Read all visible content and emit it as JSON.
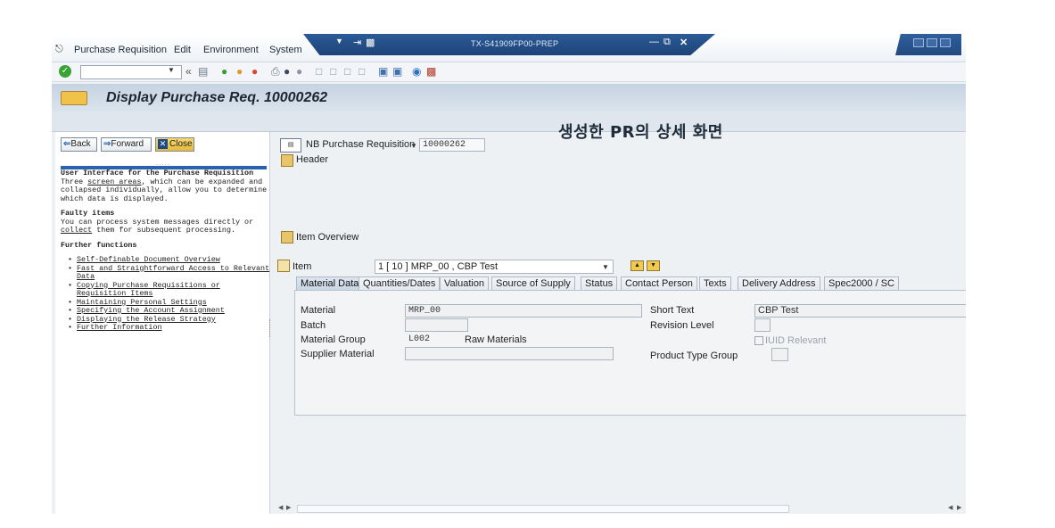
{
  "menubar": {
    "items": [
      "Purchase Requisition",
      "Edit",
      "Environment",
      "System"
    ],
    "window_title": "TX-S41909FP00-PREP"
  },
  "toolbar": {
    "command_field": ""
  },
  "page": {
    "title": "Display Purchase Req. 10000262"
  },
  "annotation": "생성한 PR의 상세 화면",
  "help": {
    "back_label": "Back",
    "forward_label": "Forward",
    "close_label": "Close",
    "heading": "User Interface for the Purchase Requisition",
    "intro_prefix": "Three ",
    "intro_link": "screen areas",
    "intro_rest": ", which can be expanded and collapsed individually, allow you to determine which data is displayed.",
    "faulty_heading": "Faulty items",
    "faulty_prefix": "You can process system messages directly or ",
    "faulty_link": "collect",
    "faulty_rest": " them for subsequent processing.",
    "functions_heading": "Further functions",
    "functions": [
      "Self-Definable Document Overview",
      "Fast and Straightforward Access to Relevant Data",
      "Copying Purchase Requisitions or Requisition Items",
      "Maintaining Personal Settings",
      "Specifying the Account Assignment",
      "Displaying the Release Strategy",
      "Further Information"
    ]
  },
  "document": {
    "doc_type": "NB Purchase Requisition",
    "doc_number": "10000262",
    "header_label": "Header",
    "item_overview_label": "Item Overview",
    "item_label": "Item",
    "item_selected": "1 [ 10 ] MRP_00 , CBP Test"
  },
  "tabs": [
    "Material Data",
    "Quantities/Dates",
    "Valuation",
    "Source of Supply",
    "Status",
    "Contact Person",
    "Texts",
    "Delivery Address",
    "Spec2000 / SC"
  ],
  "material_data": {
    "material_label": "Material",
    "material_value": "MRP_00",
    "batch_label": "Batch",
    "batch_value": "",
    "material_group_label": "Material Group",
    "material_group_value": "L002",
    "material_group_desc": "Raw Materials",
    "supplier_material_label": "Supplier Material",
    "supplier_material_value": "",
    "short_text_label": "Short Text",
    "short_text_value": "CBP Test",
    "revision_level_label": "Revision Level",
    "revision_level_value": "",
    "iuid_label": "IUID Relevant",
    "product_type_group_label": "Product Type Group",
    "product_type_group_value": ""
  }
}
